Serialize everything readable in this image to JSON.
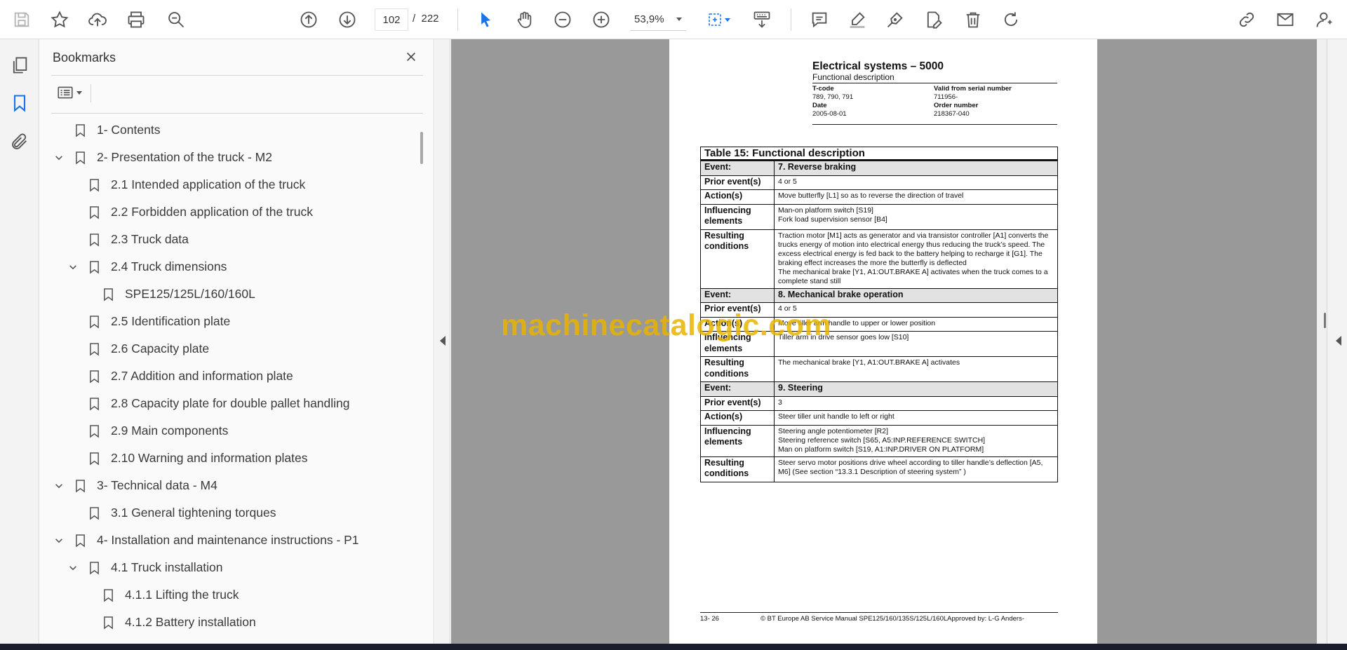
{
  "toolbar": {
    "page_current": "102",
    "page_total": "/  222",
    "zoom": "53,9%"
  },
  "sidebar": {
    "title": "Bookmarks",
    "items": [
      {
        "label": "1- Contents",
        "level": 1,
        "expanded": null
      },
      {
        "label": "2- Presentation of the truck - M2",
        "level": 1,
        "expanded": true
      },
      {
        "label": "2.1 Intended application of the truck",
        "level": 2,
        "expanded": null
      },
      {
        "label": "2.2 Forbidden application of the truck",
        "level": 2,
        "expanded": null
      },
      {
        "label": "2.3 Truck data",
        "level": 2,
        "expanded": null
      },
      {
        "label": "2.4 Truck dimensions",
        "level": 2,
        "expanded": true
      },
      {
        "label": "SPE125/125L/160/160L",
        "level": 3,
        "expanded": null
      },
      {
        "label": "2.5 Identification plate",
        "level": 2,
        "expanded": null
      },
      {
        "label": "2.6 Capacity plate",
        "level": 2,
        "expanded": null
      },
      {
        "label": "2.7 Addition and information plate",
        "level": 2,
        "expanded": null
      },
      {
        "label": "2.8 Capacity plate for double pallet handling",
        "level": 2,
        "expanded": null
      },
      {
        "label": "2.9 Main components",
        "level": 2,
        "expanded": null
      },
      {
        "label": "2.10 Warning and information plates",
        "level": 2,
        "expanded": null
      },
      {
        "label": "3- Technical data - M4",
        "level": 1,
        "expanded": true
      },
      {
        "label": "3.1 General tightening torques",
        "level": 2,
        "expanded": null
      },
      {
        "label": "4- Installation and maintenance instructions - P1",
        "level": 1,
        "expanded": true
      },
      {
        "label": "4.1 Truck installation",
        "level": 2,
        "expanded": true
      },
      {
        "label": "4.1.1 Lifting the truck",
        "level": 3,
        "expanded": null
      },
      {
        "label": "4.1.2 Battery installation",
        "level": 3,
        "expanded": null
      }
    ]
  },
  "document": {
    "title": "Electrical systems – 5000",
    "subtitle": "Functional description",
    "meta": {
      "tcode_label": "T-code",
      "tcode_value": "789, 790, 791",
      "serial_label": "Valid from serial number",
      "serial_value": "711956-",
      "date_label": "Date",
      "date_value": "2005-08-01",
      "order_label": "Order number",
      "order_value": "218367-040"
    },
    "table_caption": "Table 15: Functional description",
    "rows": [
      {
        "label": "Event:",
        "value": "7. Reverse braking",
        "event": true
      },
      {
        "label": "Prior event(s)",
        "value": "4 or 5"
      },
      {
        "label": "Action(s)",
        "value": "Move butterfly [L1] so as to reverse the direction of travel"
      },
      {
        "label": "Influencing elements",
        "value": "Man-on platform switch [S19]\nFork load supervision sensor [B4]"
      },
      {
        "label": "Resulting conditions",
        "value": "Traction motor [M1] acts as generator and via transistor controller [A1] converts the trucks energy of motion into electrical energy thus reducing the truck’s speed. The excess electrical energy is fed back to the battery helping to recharge it [G1]. The braking effect increases the more the butterfly is deflected\nThe mechanical brake [Y1, A1:OUT.BRAKE A] activates when the truck comes to a complete stand still"
      },
      {
        "label": "Event:",
        "value": "8. Mechanical brake operation",
        "event": true
      },
      {
        "label": "Prior event(s)",
        "value": "4 or 5"
      },
      {
        "label": "Action(s)",
        "value": "Move tiller arm handle to upper or lower position"
      },
      {
        "label": "Influencing elements",
        "value": "Tiller arm in drive sensor goes low [S10]"
      },
      {
        "label": "Resulting conditions",
        "value": "The mechanical brake [Y1, A1:OUT.BRAKE A] activates"
      },
      {
        "label": "Event:",
        "value": "9. Steering",
        "event": true
      },
      {
        "label": "Prior event(s)",
        "value": "3"
      },
      {
        "label": "Action(s)",
        "value": "Steer tiller unit handle to left or right"
      },
      {
        "label": "Influencing elements",
        "value": "Steering angle potentiometer [R2]\nSteering reference switch [S65, A5:INP.REFERENCE SWITCH]\nMan on platform switch [S19, A1:INP.DRIVER ON PLATFORM]"
      },
      {
        "label": "Resulting conditions",
        "value": "Steer servo motor positions drive wheel according to tiller handle’s deflection [A5, M6] (See section “13.3.1 Description of steering system”  )"
      }
    ],
    "footer": {
      "page": "13- 26",
      "text": "© BT Europe AB     Service Manual SPE125/160/135S/125L/160LApproved by: L-G Anders-"
    }
  },
  "watermark": "machinecatalogic.com",
  "colors": {
    "accent": "#1a73e8",
    "viewer_bg": "#999999",
    "watermark": "#e8b400",
    "icon": "#555555"
  }
}
